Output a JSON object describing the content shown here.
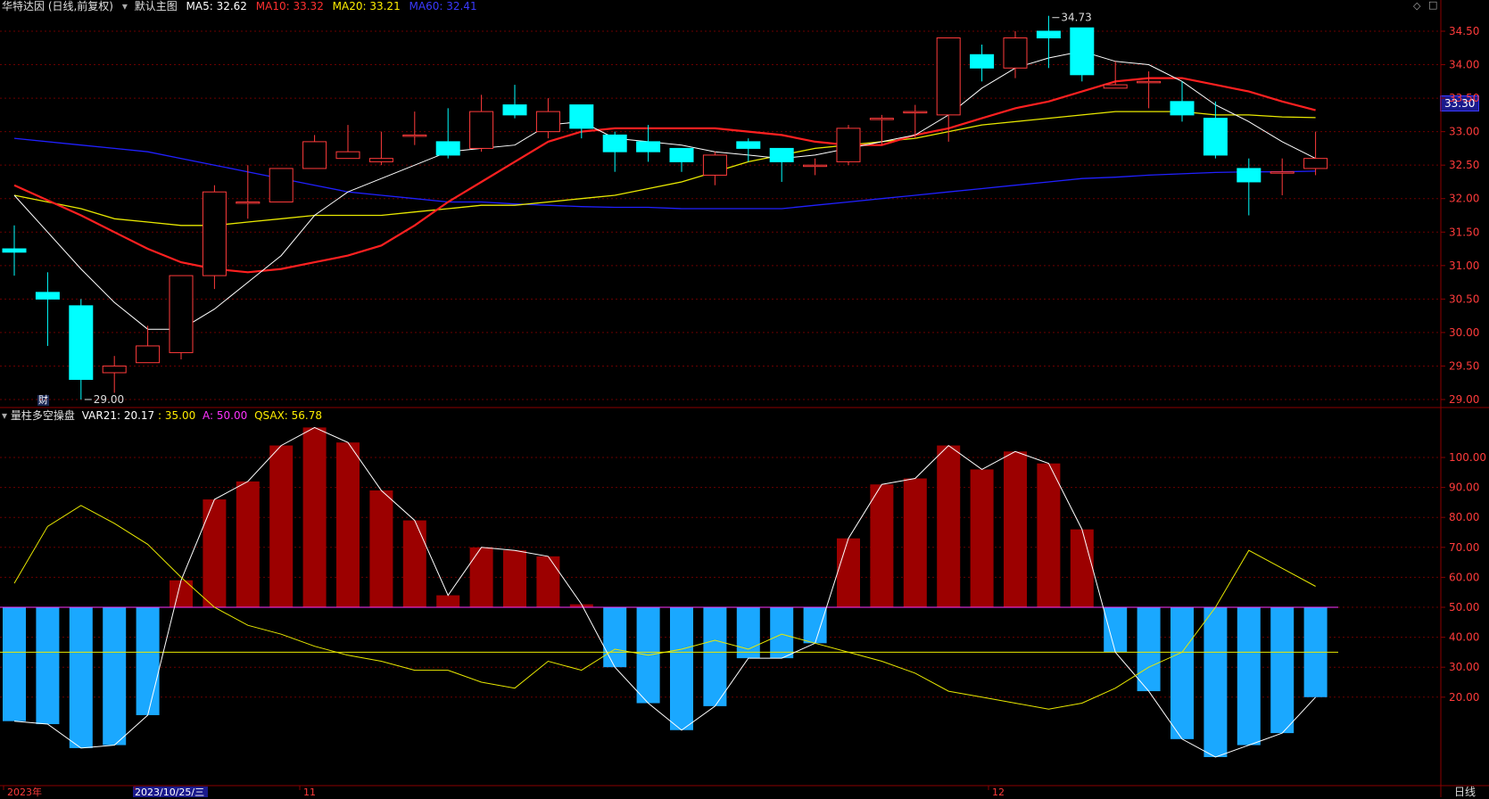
{
  "header_top": {
    "stock_title": "华特达因 (日线,前复权)",
    "template_label": "默认主图",
    "ma5": "MA5: 32.62",
    "ma10": "MA10: 33.32",
    "ma20": "MA20: 33.21",
    "ma60": "MA60: 32.41"
  },
  "header_bottom": {
    "indicator_name": "量柱多空操盘",
    "var21": "VAR21: 20.17",
    "v35": ": 35.00",
    "a": "A: 50.00",
    "qsax": "QSAX: 56.78"
  },
  "current_price_tag": "33.30",
  "high_label": "34.73",
  "low_label": "29.00",
  "finance_marker": "财",
  "period_button": "日线",
  "x_axis_labels": [
    "2023年",
    "2023/10/25/三",
    "11",
    "12"
  ],
  "colors": {
    "up": "#ff3b3b",
    "down": "#00ffff",
    "ma5": "#ffffff",
    "ma10": "#ff2020",
    "ma20": "#e8e800",
    "ma60": "#2020ff",
    "bar_up": "#9c0000",
    "bar_down": "#1aa8ff",
    "grid": "#6b0000",
    "axis_text": "#ff3b3b"
  },
  "chart_data": [
    {
      "type": "candlestick",
      "title": "华特达因 (日线,前复权)",
      "ylim": [
        28.8,
        34.8
      ],
      "y_ticks": [
        29.0,
        29.5,
        30.0,
        30.5,
        31.0,
        31.5,
        32.0,
        32.5,
        33.0,
        33.5,
        34.0,
        34.5
      ],
      "candles": [
        {
          "o": 31.25,
          "c": 31.2,
          "h": 31.6,
          "l": 30.85
        },
        {
          "o": 30.6,
          "c": 30.5,
          "h": 30.9,
          "l": 29.8
        },
        {
          "o": 30.4,
          "c": 29.3,
          "h": 30.5,
          "l": 29.0
        },
        {
          "o": 29.4,
          "c": 29.5,
          "h": 29.65,
          "l": 29.1
        },
        {
          "o": 29.55,
          "c": 29.8,
          "h": 30.1,
          "l": 29.55
        },
        {
          "o": 29.7,
          "c": 30.85,
          "h": 30.85,
          "l": 29.6
        },
        {
          "o": 30.85,
          "c": 32.1,
          "h": 32.2,
          "l": 30.65
        },
        {
          "o": 31.95,
          "c": 31.95,
          "h": 32.5,
          "l": 31.7
        },
        {
          "o": 31.95,
          "c": 32.45,
          "h": 32.45,
          "l": 31.95
        },
        {
          "o": 32.45,
          "c": 32.85,
          "h": 32.95,
          "l": 32.45
        },
        {
          "o": 32.6,
          "c": 32.7,
          "h": 33.1,
          "l": 32.6
        },
        {
          "o": 32.55,
          "c": 32.6,
          "h": 33.0,
          "l": 32.5
        },
        {
          "o": 32.95,
          "c": 32.95,
          "h": 33.3,
          "l": 32.8
        },
        {
          "o": 32.85,
          "c": 32.65,
          "h": 33.35,
          "l": 32.6
        },
        {
          "o": 32.75,
          "c": 33.3,
          "h": 33.55,
          "l": 32.7
        },
        {
          "o": 33.4,
          "c": 33.25,
          "h": 33.7,
          "l": 33.2
        },
        {
          "o": 33.0,
          "c": 33.3,
          "h": 33.5,
          "l": 32.9
        },
        {
          "o": 33.4,
          "c": 33.05,
          "h": 33.4,
          "l": 32.9
        },
        {
          "o": 32.95,
          "c": 32.7,
          "h": 33.0,
          "l": 32.4
        },
        {
          "o": 32.85,
          "c": 32.7,
          "h": 33.1,
          "l": 32.55
        },
        {
          "o": 32.75,
          "c": 32.55,
          "h": 32.75,
          "l": 32.4
        },
        {
          "o": 32.35,
          "c": 32.65,
          "h": 32.7,
          "l": 32.2
        },
        {
          "o": 32.85,
          "c": 32.75,
          "h": 32.9,
          "l": 32.55
        },
        {
          "o": 32.75,
          "c": 32.55,
          "h": 32.75,
          "l": 32.25
        },
        {
          "o": 32.5,
          "c": 32.5,
          "h": 32.6,
          "l": 32.35
        },
        {
          "o": 32.55,
          "c": 33.05,
          "h": 33.1,
          "l": 32.5
        },
        {
          "o": 33.2,
          "c": 33.2,
          "h": 33.25,
          "l": 32.8
        },
        {
          "o": 33.3,
          "c": 33.3,
          "h": 33.4,
          "l": 32.9
        },
        {
          "o": 33.25,
          "c": 34.4,
          "h": 34.4,
          "l": 32.85
        },
        {
          "o": 34.15,
          "c": 33.95,
          "h": 34.3,
          "l": 33.75
        },
        {
          "o": 33.95,
          "c": 34.4,
          "h": 34.5,
          "l": 33.8
        },
        {
          "o": 34.5,
          "c": 34.4,
          "h": 34.73,
          "l": 33.95
        },
        {
          "o": 34.55,
          "c": 33.85,
          "h": 34.55,
          "l": 33.75
        },
        {
          "o": 33.65,
          "c": 33.7,
          "h": 34.05,
          "l": 33.65
        },
        {
          "o": 33.75,
          "c": 33.75,
          "h": 33.9,
          "l": 33.35
        },
        {
          "o": 33.45,
          "c": 33.25,
          "h": 33.75,
          "l": 33.15
        },
        {
          "o": 33.2,
          "c": 32.65,
          "h": 33.45,
          "l": 32.6
        },
        {
          "o": 32.45,
          "c": 32.25,
          "h": 32.6,
          "l": 31.75
        },
        {
          "o": 32.4,
          "c": 32.4,
          "h": 32.6,
          "l": 32.05
        },
        {
          "o": 32.45,
          "c": 32.6,
          "h": 33.0,
          "l": 32.35
        }
      ],
      "ma5": [
        32.05,
        null,
        30.95,
        30.45,
        30.05,
        30.05,
        30.35,
        30.75,
        31.15,
        31.75,
        32.1,
        32.3,
        32.5,
        32.7,
        32.75,
        32.8,
        33.1,
        33.15,
        32.9,
        32.85,
        32.8,
        32.7,
        32.65,
        32.6,
        32.65,
        32.75,
        32.85,
        32.95,
        33.25,
        33.65,
        33.95,
        34.1,
        34.2,
        34.05,
        34.0,
        33.75,
        33.4,
        33.15,
        32.85,
        32.6
      ],
      "ma10": [
        32.2,
        null,
        31.75,
        31.5,
        31.25,
        31.05,
        30.95,
        30.9,
        30.95,
        31.05,
        31.15,
        31.3,
        31.6,
        31.95,
        32.25,
        32.55,
        32.85,
        33.0,
        33.05,
        33.05,
        33.05,
        33.05,
        33.0,
        32.95,
        32.85,
        32.8,
        32.8,
        32.95,
        33.05,
        33.2,
        33.35,
        33.45,
        33.6,
        33.75,
        33.8,
        33.8,
        33.7,
        33.6,
        33.45,
        33.32
      ],
      "ma20": [
        32.05,
        null,
        31.85,
        31.7,
        31.65,
        31.6,
        31.6,
        31.65,
        31.7,
        31.75,
        31.75,
        31.75,
        31.8,
        31.85,
        31.9,
        31.9,
        31.95,
        32.0,
        32.05,
        32.15,
        32.25,
        32.4,
        32.55,
        32.65,
        32.75,
        32.8,
        32.85,
        32.9,
        33.0,
        33.1,
        33.15,
        33.2,
        33.25,
        33.3,
        33.3,
        33.3,
        33.25,
        33.25,
        33.22,
        33.21
      ],
      "ma60": [
        32.9,
        null,
        32.8,
        32.75,
        32.7,
        32.6,
        32.5,
        32.4,
        32.3,
        32.2,
        32.1,
        32.05,
        32.0,
        31.95,
        31.95,
        31.92,
        31.9,
        31.88,
        31.87,
        31.87,
        31.85,
        31.85,
        31.85,
        31.85,
        31.9,
        31.95,
        32.0,
        32.05,
        32.1,
        32.15,
        32.2,
        32.25,
        32.3,
        32.32,
        32.35,
        32.37,
        32.39,
        32.4,
        32.4,
        32.41
      ]
    },
    {
      "type": "bar",
      "title": "量柱多空操盘",
      "ylim": [
        0,
        115
      ],
      "y_ticks": [
        20.0,
        30.0,
        40.0,
        50.0,
        60.0,
        70.0,
        80.0,
        90.0,
        100.0
      ],
      "baseline": 50,
      "var21": [
        12,
        11,
        3,
        4,
        14,
        59,
        86,
        92,
        104,
        110,
        105,
        89,
        79,
        54,
        70,
        69,
        67,
        51,
        30,
        18,
        9,
        17,
        33,
        33,
        38,
        73,
        91,
        93,
        104,
        96,
        102,
        98,
        76,
        35,
        22,
        6,
        0,
        4,
        8,
        20
      ],
      "qsax": [
        58,
        77,
        84,
        78,
        71,
        60,
        50,
        44,
        41,
        37,
        34,
        32,
        29,
        29,
        25,
        23,
        32,
        29,
        36,
        34,
        36,
        39,
        36,
        41,
        38,
        35,
        32,
        28,
        22,
        20,
        18,
        16,
        18,
        23,
        30,
        35,
        50,
        69,
        63,
        57
      ],
      "level_35": 35,
      "level_a": 50
    }
  ]
}
